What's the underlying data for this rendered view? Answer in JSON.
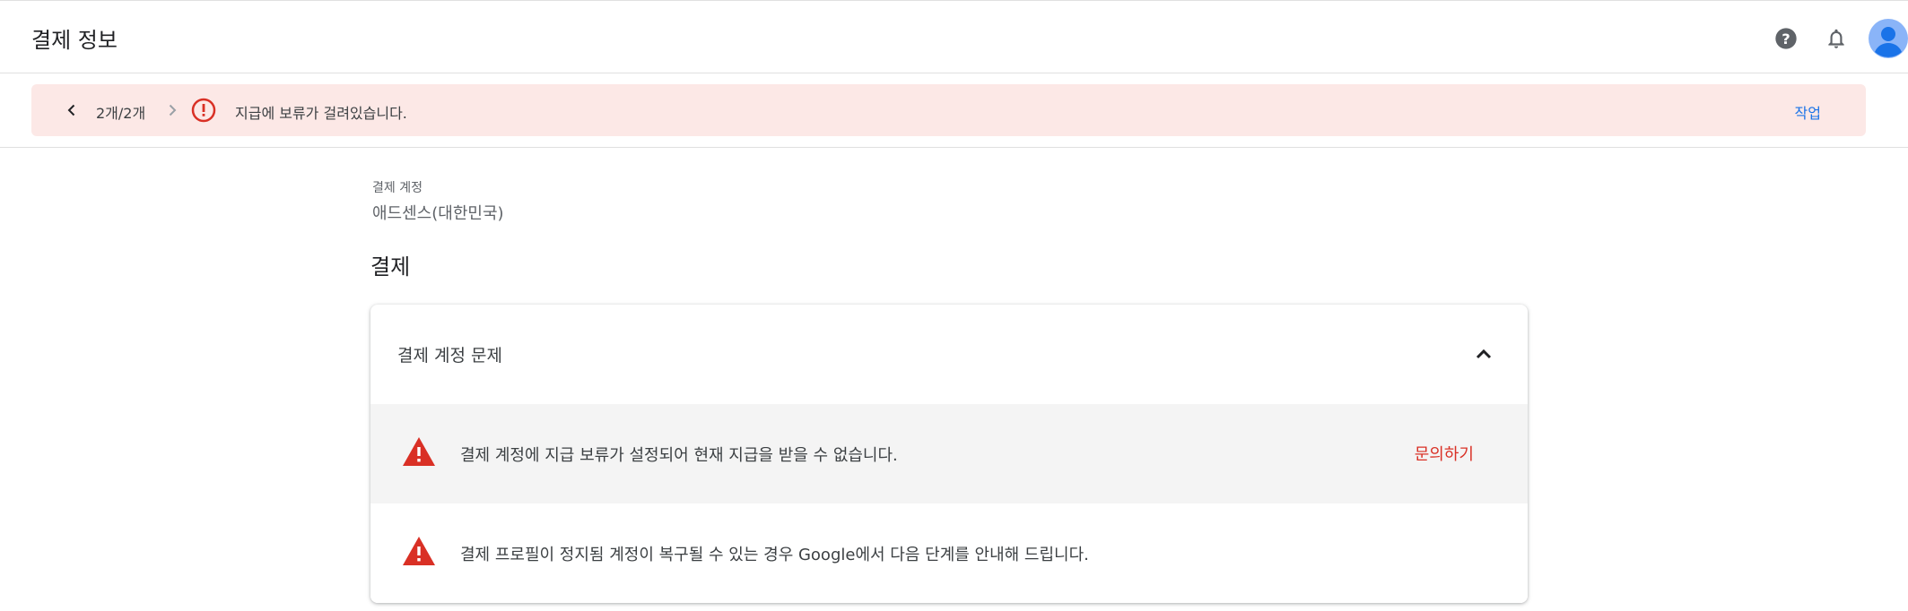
{
  "header": {
    "title": "결제 정보",
    "icons": [
      "help-icon",
      "notifications-icon",
      "account-avatar"
    ]
  },
  "alert": {
    "pager": "2개/2개",
    "message": "지급에 보류가 걸려있습니다.",
    "action": "작업",
    "color": "#fce8e6"
  },
  "account": {
    "label": "결제 계정",
    "name": "애드센스(대한민국)"
  },
  "section": {
    "title": "결제"
  },
  "issues_card": {
    "title": "결제 계정 문제",
    "rows": [
      {
        "text": "결제 계정에 지급 보류가 설정되어 현재 지급을 받을 수 없습니다.",
        "link": "문의하기"
      },
      {
        "text": "결제 프로필이 정지됨 계정이 복구될 수 있는 경우 Google에서 다음 단계를 안내해 드립니다."
      }
    ]
  },
  "colors": {
    "link_blue": "#1a73e8",
    "link_red": "#d93025",
    "warning_red": "#d93025",
    "avatar_blue": "#8ab4f8"
  }
}
